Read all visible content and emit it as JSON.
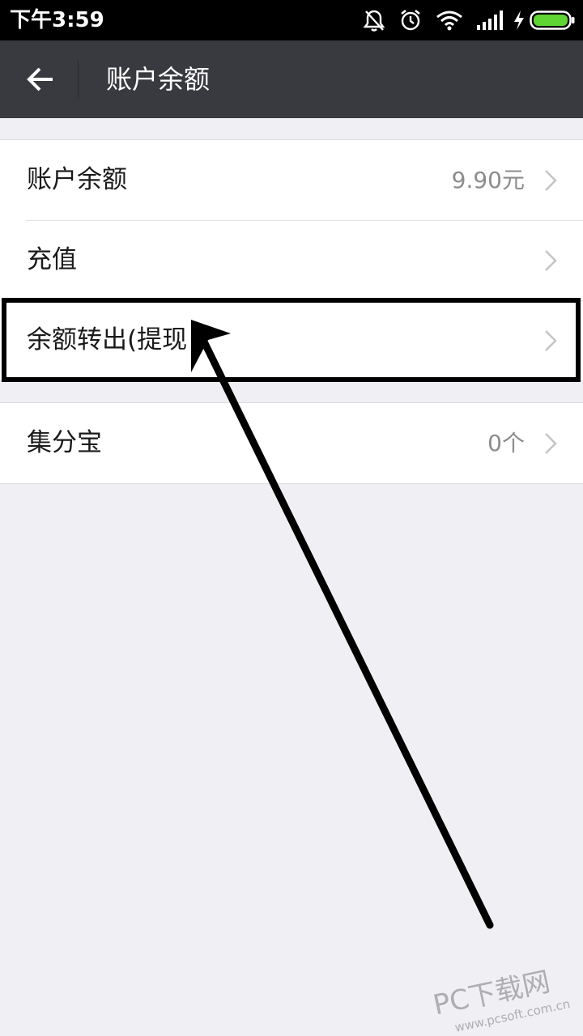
{
  "status_bar": {
    "time": "下午3:59",
    "icons": [
      "bell-off-icon",
      "alarm-icon",
      "wifi-icon",
      "signal-icon",
      "charging-icon",
      "battery-icon"
    ]
  },
  "app_bar": {
    "back_icon": "arrow-left-icon",
    "title": "账户余额"
  },
  "groups": [
    {
      "rows": [
        {
          "label": "账户余额",
          "value": "9.90元"
        },
        {
          "label": "充值",
          "value": ""
        },
        {
          "label": "余额转出(提现",
          "value": ""
        }
      ]
    },
    {
      "rows": [
        {
          "label": "集分宝",
          "value": "0个"
        }
      ]
    }
  ],
  "annotation": {
    "highlighted_row": "余额转出(提现",
    "color": "#000000"
  },
  "colors": {
    "status_bar_bg": "#000000",
    "app_bar_bg": "#393a3f",
    "page_bg": "#efeff4",
    "row_bg": "#ffffff",
    "value_text": "#8c8c8c",
    "battery_fill": "#5fd534"
  },
  "watermark": {
    "text": "PC下载网",
    "url": "www.pcsoft.com.cn"
  }
}
